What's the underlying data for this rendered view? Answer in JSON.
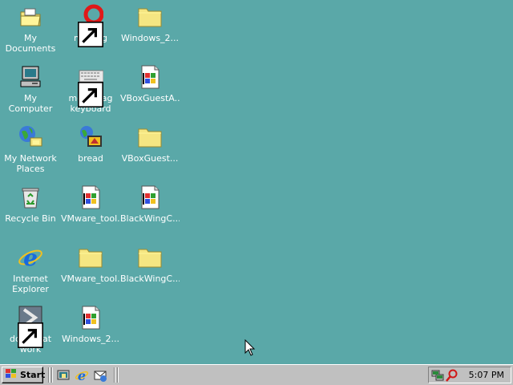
{
  "desktop": {
    "icons": [
      {
        "label": "My Documents",
        "icon": "my-documents-icon"
      },
      {
        "label": "nothing",
        "icon": "red-ring-icon",
        "shortcut": true
      },
      {
        "label": "Windows_2...",
        "icon": "folder-icon"
      },
      {
        "label": "My Computer",
        "icon": "my-computer-icon"
      },
      {
        "label": "mobilefag keyboard",
        "icon": "keyboard-icon",
        "shortcut": true
      },
      {
        "label": "VBoxGuestA...",
        "icon": "windows-exe-icon"
      },
      {
        "label": "My Network Places",
        "icon": "network-places-icon"
      },
      {
        "label": "bread",
        "icon": "bread-icon"
      },
      {
        "label": "VBoxGuest...",
        "icon": "folder-icon"
      },
      {
        "label": "Recycle Bin",
        "icon": "recycle-bin-icon"
      },
      {
        "label": "VMware_tool...",
        "icon": "windows-exe-icon"
      },
      {
        "label": "BlackWingC...",
        "icon": "windows-exe-icon"
      },
      {
        "label": "Internet Explorer",
        "icon": "internet-explorer-icon"
      },
      {
        "label": "VMware_tool...",
        "icon": "folder-icon"
      },
      {
        "label": "BlackWingC...",
        "icon": "folder-icon"
      },
      {
        "label": "does that work",
        "icon": "shortcut-arrow-icon",
        "shortcut": true
      },
      {
        "label": "Windows_2...",
        "icon": "windows-exe-icon"
      }
    ]
  },
  "taskbar": {
    "start_label": "Start",
    "quick_launch": [
      "show-desktop-icon",
      "internet-explorer-icon",
      "outlook-express-icon"
    ],
    "tray_icons": [
      "network-tray-icon",
      "search-tray-icon"
    ],
    "clock": "5:07 PM"
  },
  "colors": {
    "desktop": "#5aa8a8",
    "taskbar": "#c0c0c0",
    "folder": "#f5e682"
  }
}
